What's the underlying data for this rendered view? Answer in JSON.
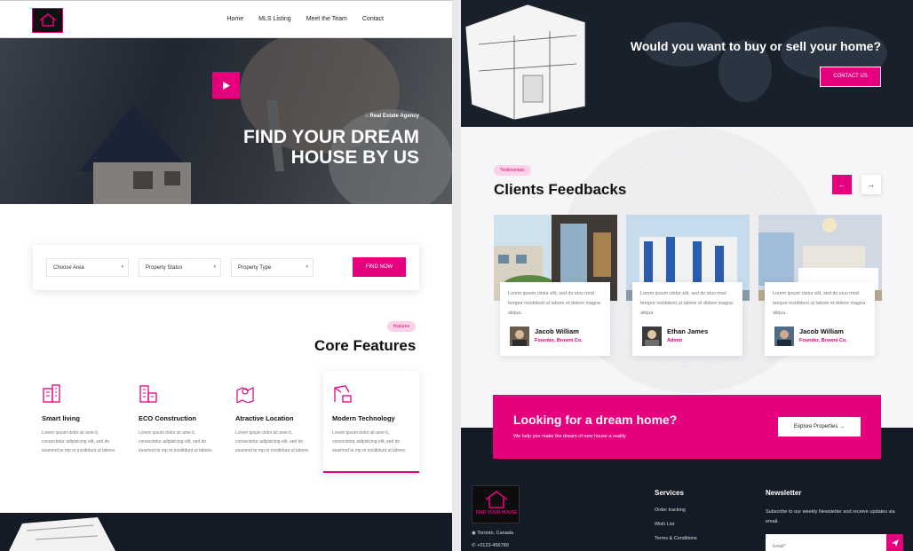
{
  "brand": {
    "accent": "#e6007e",
    "dark": "#151b26",
    "logo_text": "FIND YOUR HOUSE"
  },
  "nav": [
    "Home",
    "MLS Listing",
    "Meet the Team",
    "Contact"
  ],
  "hero": {
    "tag": "Real Estate Agency",
    "title": "FIND YOUR DREAM HOUSE BY US"
  },
  "search": {
    "area": "Choose Area",
    "status": "Property Status",
    "type": "Property Type",
    "button": "FIND NOW"
  },
  "features": {
    "pill": "features",
    "title": "Core Features",
    "items": [
      {
        "title": "Smart living",
        "desc": "Lorem ipsum dolor sit ame it, consectetur adipisicing elit, sed do eiusmod te mp or incididunt ut labore."
      },
      {
        "title": "ECO Construction",
        "desc": "Lorem ipsum dolor sit ame it, consectetur adipisicing elit, sed do eiusmod te mp or incididunt ut labore."
      },
      {
        "title": "Atractive Location",
        "desc": "Lorem ipsum dolor sit ame it, consectetur adipisicing elit, sed do eiusmod te mp or incididunt ut labore."
      },
      {
        "title": "Modern Technology",
        "desc": "Lorem ipsum dolor sit ame it, consectetur adipisicing elit, sed do eiusmod te mp or incididunt ut labore."
      }
    ]
  },
  "cta": {
    "title": "Would you want to buy or sell your home?",
    "button": "CONTACT US"
  },
  "testimonials": {
    "pill": "Testimonials",
    "title": "Clients Feedbacks",
    "prev": "←",
    "next": "→",
    "items": [
      {
        "quote": "Lorem ipsum cletur elit, sed do eius mod tempor incididunt ut labore et dolore magna aliqua.",
        "name": "Jacob William",
        "role": "Founder, Browni Co."
      },
      {
        "quote": "Lorem ipsum cletur elit, sed do eius mod tempor incididunt ut labore et dolore magna aliqua.",
        "name": "Ethan James",
        "role": "Admin"
      },
      {
        "quote": "Lorem ipsum cletur elit, sed do eius mod tempor incididunt ut labore et dolore magna aliqua.",
        "name": "Jacob William",
        "role": "Founder, Browni Co."
      }
    ]
  },
  "dream": {
    "title": "Looking for a dream home?",
    "desc": "We help you make the dream of new house a reality",
    "button": "Explore Properties →"
  },
  "footer": {
    "location": "Toronto, Canada",
    "phone": "+0123-456789",
    "services_title": "Services",
    "services": [
      "Order tracking",
      "Wish List",
      "Terms & Conditions"
    ],
    "newsletter_title": "Newsletter",
    "newsletter_desc": "Subscribe to our weekly Newsletter and receive updates via email.",
    "email_placeholder": "Email*"
  }
}
